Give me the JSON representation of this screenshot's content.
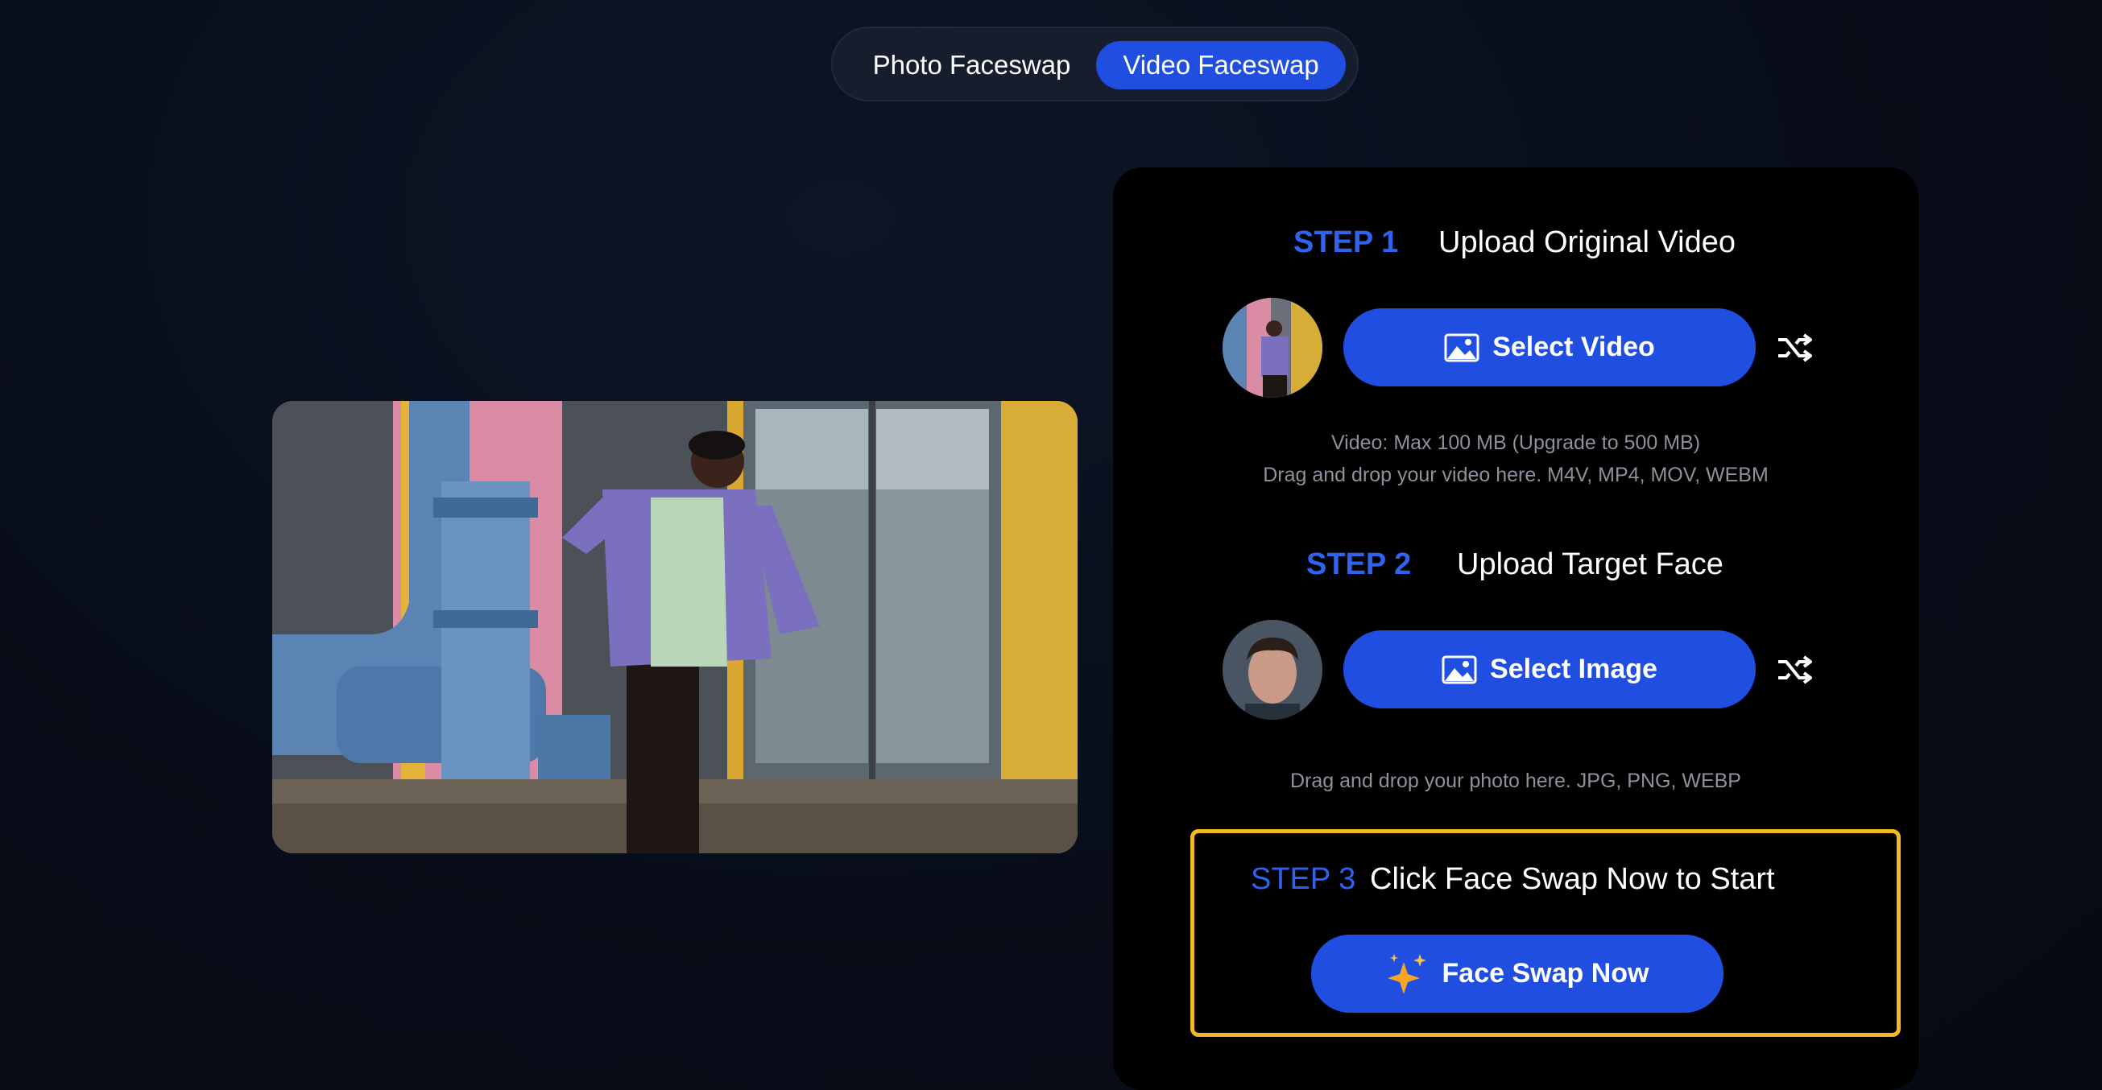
{
  "mode_tabs": {
    "photo": "Photo Faceswap",
    "video": "Video Faceswap",
    "active": "Video Faceswap"
  },
  "step1": {
    "number": "STEP 1",
    "title": "Upload Original Video",
    "button": "Select Video",
    "hint_line1": "Video: Max 100 MB (Upgrade to 500 MB)",
    "hint_line2": "Drag and drop your video here. M4V, MP4, MOV, WEBM"
  },
  "step2": {
    "number": "STEP 2",
    "title": "Upload Target Face",
    "button": "Select Image",
    "hint": "Drag and drop your photo here. JPG, PNG, WEBP"
  },
  "step3": {
    "number": "STEP 3",
    "title": "Click Face Swap Now to Start",
    "button": "Face Swap Now"
  },
  "icons": {
    "select_video": "image-icon",
    "select_image": "image-icon",
    "shuffle": "shuffle-icon",
    "sparkle": "sparkle-icon"
  },
  "colors": {
    "accent": "#1f4ee0",
    "step_label": "#2f62ee",
    "highlight_border": "#f1b924",
    "panel_bg": "#000000"
  }
}
